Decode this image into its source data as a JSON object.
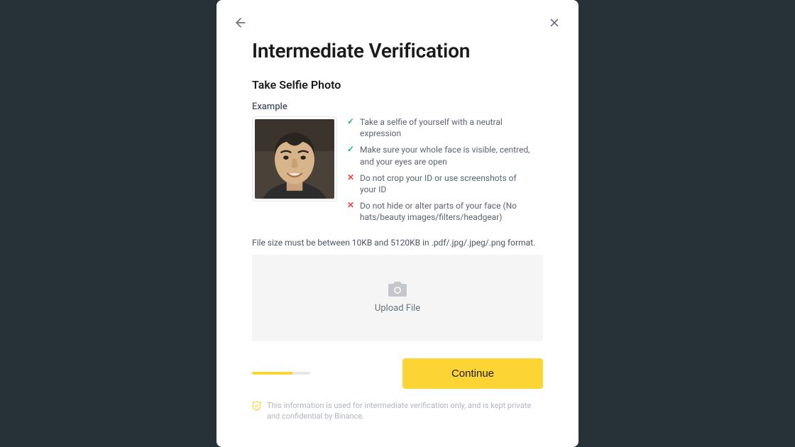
{
  "title": "Intermediate Verification",
  "subtitle": "Take Selfie Photo",
  "example_label": "Example",
  "rules": [
    {
      "type": "ok",
      "text": "Take a selfie of yourself with a neutral expression"
    },
    {
      "type": "ok",
      "text": "Make sure your whole face is visible, centred, and your eyes are open"
    },
    {
      "type": "no",
      "text": "Do not crop your ID or use screenshots of your ID"
    },
    {
      "type": "no",
      "text": "Do not hide or alter parts of your face (No hats/beauty images/filters/headgear)"
    }
  ],
  "file_hint": "File size must be between 10KB and 5120KB in .pdf/.jpg/.jpeg/.png format.",
  "upload_label": "Upload File",
  "continue_label": "Continue",
  "progress_pct": 70,
  "footnote": "This information is used for intermediate verification only, and is kept private and confidential by Binance.",
  "colors": {
    "accent": "#fcd535",
    "ok": "#10b981",
    "no": "#ef4444"
  }
}
